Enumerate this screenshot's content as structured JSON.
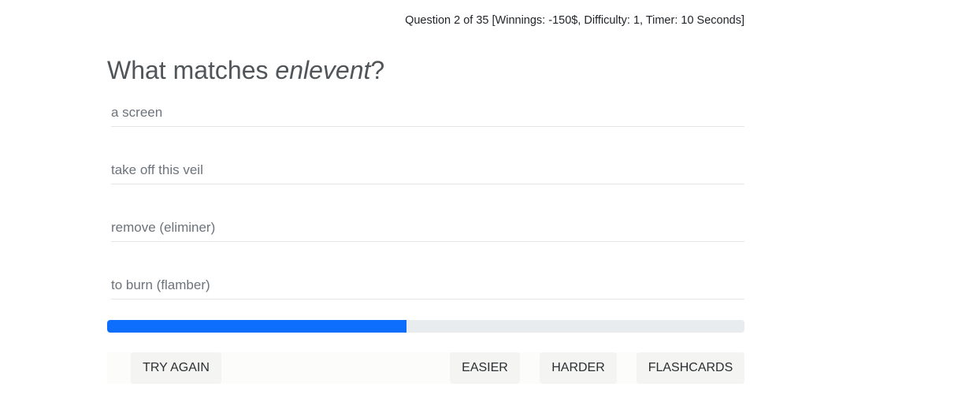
{
  "status": {
    "text": "Question 2 of 35 [Winnings: -150$, Difficulty: 1, Timer: 10 Seconds]"
  },
  "question": {
    "prefix": "What matches ",
    "word": "enlevent",
    "suffix": "?"
  },
  "answers": [
    {
      "label": "a screen"
    },
    {
      "label": "take off this veil"
    },
    {
      "label": "remove (eliminer)"
    },
    {
      "label": "to burn (flamber)"
    }
  ],
  "progress": {
    "fraction": 0.47,
    "color": "#0d6efd",
    "track_color": "#e9ecef"
  },
  "buttons": {
    "try_again": "TRY AGAIN",
    "easier": "EASIER",
    "harder": "HARDER",
    "flashcards": "FLASHCARDS"
  }
}
